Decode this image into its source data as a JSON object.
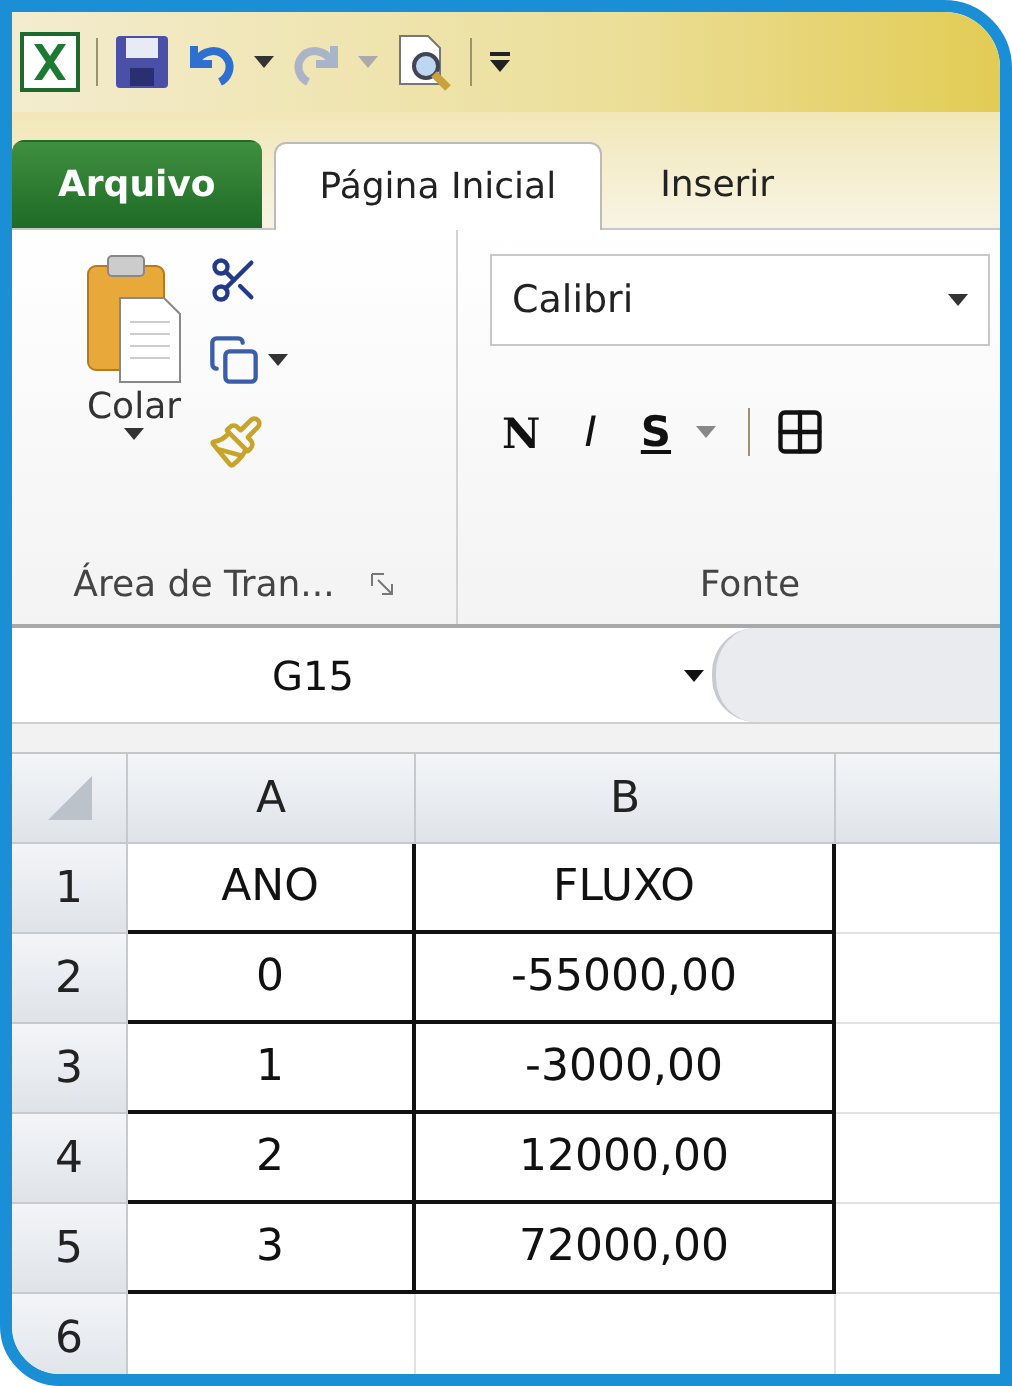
{
  "tabs": [
    {
      "label": "Arquivo",
      "kind": "file",
      "selected": false
    },
    {
      "label": "Página Inicial",
      "kind": "tab",
      "selected": true
    },
    {
      "label": "Inserir",
      "kind": "tab",
      "selected": false
    }
  ],
  "clipboard": {
    "paste_label": "Colar",
    "group_label": "Área de Tran..."
  },
  "font": {
    "font_name": "Calibri",
    "format_buttons": [
      {
        "label": "N",
        "kind": "bold",
        "dropdown": false
      },
      {
        "label": "I",
        "kind": "italic",
        "dropdown": false
      },
      {
        "label": "S",
        "kind": "underline",
        "dropdown": true
      }
    ],
    "group_label": "Fonte"
  },
  "name_box": "G15",
  "sheet": {
    "columns": [
      "A",
      "B"
    ],
    "rows": [
      {
        "number": "1",
        "cells": [
          "ANO",
          "FLUXO"
        ],
        "bordered": true
      },
      {
        "number": "2",
        "cells": [
          "0",
          "-55000,00"
        ],
        "bordered": true
      },
      {
        "number": "3",
        "cells": [
          "1",
          "-3000,00"
        ],
        "bordered": true
      },
      {
        "number": "4",
        "cells": [
          "2",
          "12000,00"
        ],
        "bordered": true
      },
      {
        "number": "5",
        "cells": [
          "3",
          "72000,00"
        ],
        "bordered": true
      },
      {
        "number": "6",
        "cells": [],
        "bordered": false
      }
    ]
  }
}
